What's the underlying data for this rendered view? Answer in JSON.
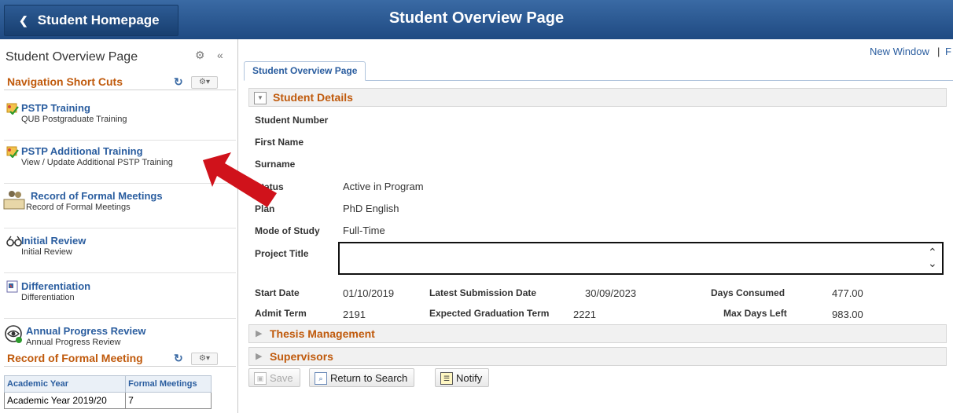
{
  "header": {
    "back_label": "Student Homepage",
    "title": "Student Overview Page"
  },
  "sidebar": {
    "title": "Student Overview Page",
    "nav_section_title": "Navigation Short Cuts",
    "items": [
      {
        "title": "PSTP Training",
        "subtitle": "QUB Postgraduate Training"
      },
      {
        "title": "PSTP Additional Training",
        "subtitle": "View / Update Additional PSTP Training"
      },
      {
        "title": "Record of Formal Meetings",
        "subtitle": "Record of Formal Meetings"
      },
      {
        "title": "Initial Review",
        "subtitle": "Initial Review"
      },
      {
        "title": "Differentiation",
        "subtitle": "Differentiation"
      },
      {
        "title": "Annual Progress Review",
        "subtitle": "Annual Progress Review"
      }
    ],
    "options_label": "⚙▾",
    "rfm_section_title": "Record of Formal Meeting",
    "rfm_table": {
      "headers": [
        "Academic Year",
        "Formal Meetings"
      ],
      "rows": [
        [
          "Academic Year 2019/20",
          "7"
        ]
      ]
    }
  },
  "links": {
    "new_window": "New Window",
    "separator": "|",
    "truncated": "F"
  },
  "tab": {
    "label": "Student Overview Page"
  },
  "details": {
    "section_title": "Student Details",
    "student_number_label": "Student Number",
    "first_name_label": "First Name",
    "surname_label": "Surname",
    "status_label": "Status",
    "status_value": "Active in Program",
    "plan_label": "Plan",
    "plan_value": "PhD English",
    "mode_label": "Mode of Study",
    "mode_value": "Full-Time",
    "project_title_label": "Project Title",
    "project_title_value": "",
    "start_date_label": "Start Date",
    "start_date_value": "01/10/2019",
    "latest_submission_label": "Latest Submission Date",
    "latest_submission_value": "30/09/2023",
    "days_consumed_label": "Days Consumed",
    "days_consumed_value": "477.00",
    "admit_term_label": "Admit Term",
    "admit_term_value": "2191",
    "expected_grad_label": "Expected Graduation Term",
    "expected_grad_value": "2221",
    "max_days_left_label": "Max Days Left",
    "max_days_left_value": "983.00"
  },
  "sections": {
    "thesis": "Thesis Management",
    "supervisors": "Supervisors"
  },
  "buttons": {
    "save": "Save",
    "return_to_search": "Return to Search",
    "notify": "Notify"
  },
  "colors": {
    "header_blue": "#1f4a82",
    "section_orange": "#c05a0c",
    "link_blue": "#2a5d9f",
    "arrow_red": "#d0121b"
  }
}
